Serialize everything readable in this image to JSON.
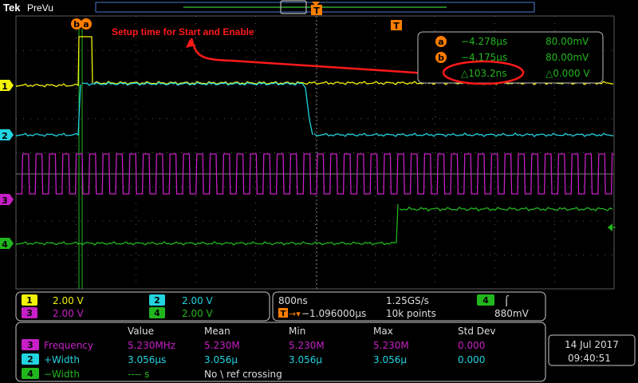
{
  "header": {
    "brand": "Tek",
    "mode": "PreVu"
  },
  "annotation": {
    "text": "Setup time for Start and Enable"
  },
  "trigger_marker": "T",
  "cursor_labels": {
    "b": "b",
    "a": "a"
  },
  "cursor_readout": {
    "a_time": "−4.278µs",
    "a_volt": "80.00mV",
    "b_time": "−4.175µs",
    "b_volt": "80.00mV",
    "delta_time": "△103.2ns",
    "delta_volt": "△0.000 V"
  },
  "channels": [
    {
      "num": "1",
      "scale": "2.00 V",
      "color": "#f2f20a"
    },
    {
      "num": "2",
      "scale": "2.00 V",
      "color": "#22d3e0"
    },
    {
      "num": "3",
      "scale": "2.00 V",
      "color": "#c71fc7"
    },
    {
      "num": "4",
      "scale": "2.00 V",
      "color": "#22b61e"
    }
  ],
  "timebase": {
    "horizontal": "800ns",
    "sample_rate": "1.25GS/s",
    "trigger_pos": "−1.096000µs",
    "record": "10k points",
    "trigger_channel": "4",
    "trigger_slope": "⌠",
    "trigger_level": "880mV"
  },
  "measurements": {
    "headers": [
      "Value",
      "Mean",
      "Min",
      "Max",
      "Std Dev"
    ],
    "rows": [
      {
        "ch": "3",
        "name": "Frequency",
        "value": "5.230MHz",
        "mean": "5.230M",
        "min": "5.230M",
        "max": "5.230M",
        "std": "0.000"
      },
      {
        "ch": "2",
        "name": "+Width",
        "value": "3.056µs",
        "mean": "3.056µ",
        "min": "3.056µ",
        "max": "3.056µ",
        "std": "0.000"
      },
      {
        "ch": "4",
        "name": "−Width",
        "value": "---- s",
        "note": "No \\ ref crossing"
      }
    ]
  },
  "datetime": {
    "date": "14 Jul  2017",
    "time": "09:40:51"
  },
  "colors": {
    "accent": "#ff7d00",
    "annotation": "#ff1a1a",
    "grid": "#5a5a5a",
    "readout": "#22b61e"
  }
}
